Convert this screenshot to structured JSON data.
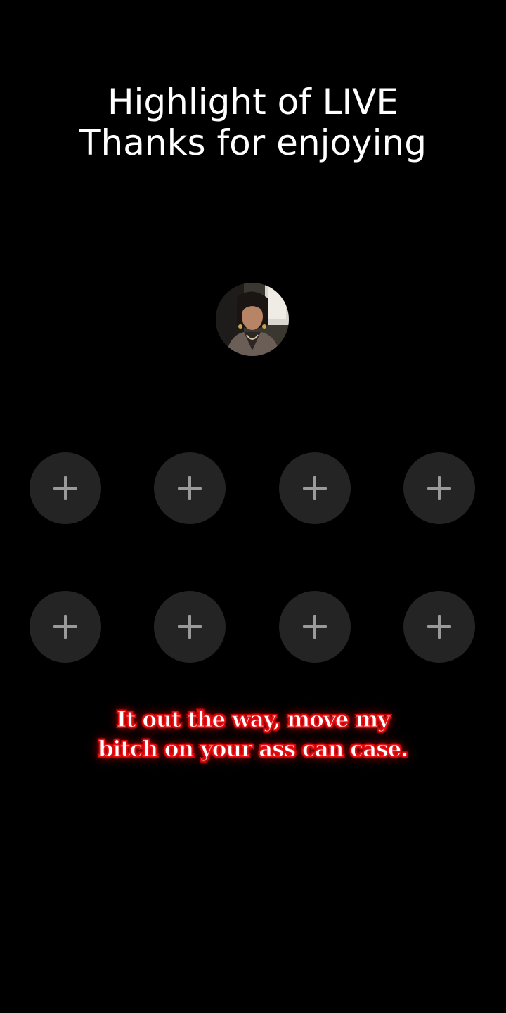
{
  "header": {
    "line1": "Highlight of LIVE",
    "line2": "Thanks for enjoying"
  },
  "host": {
    "avatar_icon": "user-avatar"
  },
  "slots": {
    "icon": "plus-icon",
    "count": 8
  },
  "caption": {
    "line1": "It out the way, move my",
    "line2": "bitch on your ass can case.",
    "color": "#e8141b"
  },
  "colors": {
    "background": "#000000",
    "slot_background": "#242424",
    "plus_color": "#9a9a9a",
    "title_color": "#ffffff"
  }
}
